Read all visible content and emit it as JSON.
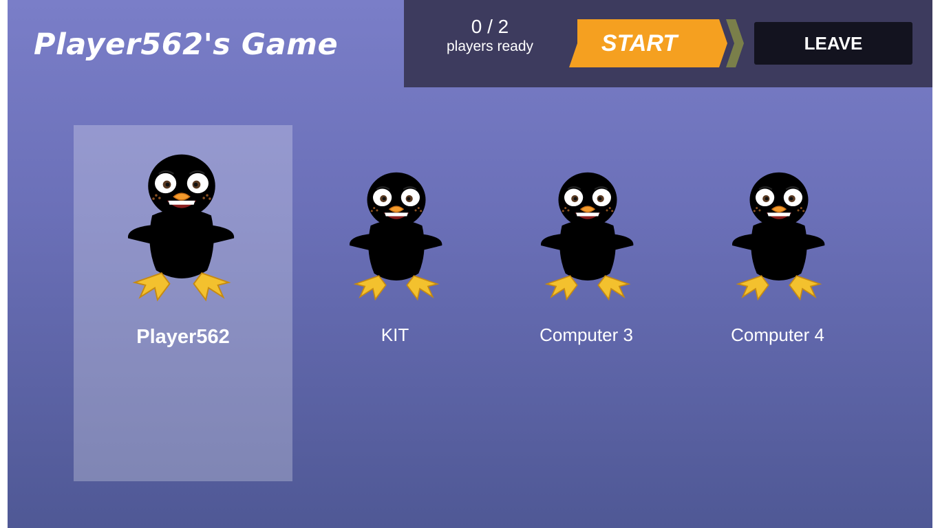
{
  "title": "Player562's Game",
  "status": {
    "count": "0 / 2",
    "label": "players ready"
  },
  "buttons": {
    "start": "START",
    "leave": "LEAVE"
  },
  "players": [
    {
      "name": "Player562",
      "color": "#1f6ff0",
      "selected": true,
      "icon": "blue-bird-icon"
    },
    {
      "name": "KIT",
      "color": "#f2e21b",
      "selected": false,
      "icon": "yellow-bird-icon"
    },
    {
      "name": "Computer 3",
      "color": "#d42c10",
      "selected": false,
      "icon": "red-bird-icon"
    },
    {
      "name": "Computer 4",
      "color": "#db8412",
      "selected": false,
      "icon": "orange-bird-icon"
    }
  ],
  "colors": {
    "accent": "#f5a020",
    "topbar": "#3d3b5e",
    "leave": "#13131f"
  }
}
